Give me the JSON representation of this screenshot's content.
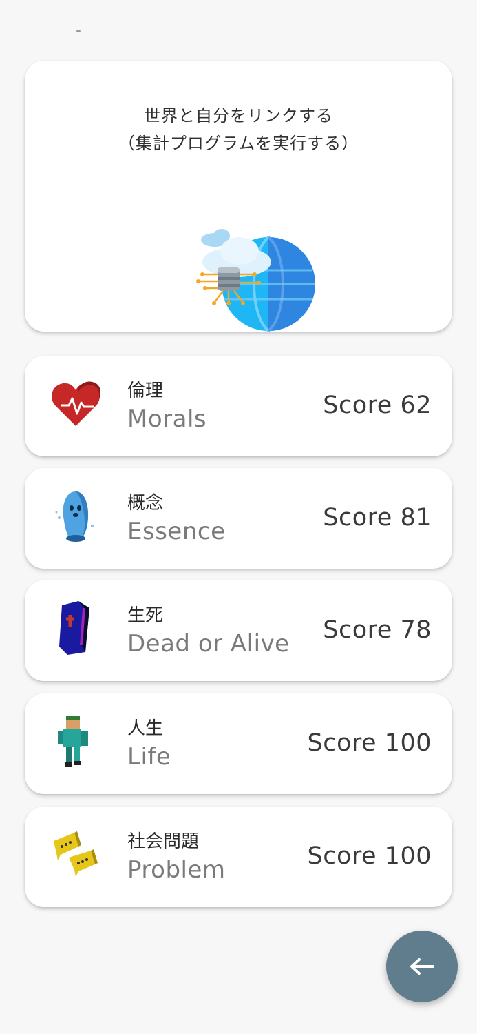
{
  "hero": {
    "line1": "世界と自分をリンクする",
    "line2": "（集計プログラムを実行する）",
    "illustration": "globe-server-cloud-icon"
  },
  "categories": [
    {
      "jp": "倫理",
      "en": "Morals",
      "score": "Score 62",
      "icon": "heart-pulse-icon",
      "color": "#d32f2f"
    },
    {
      "jp": "概念",
      "en": "Essence",
      "score": "Score 81",
      "icon": "ghost-icon",
      "color": "#5aa9e6"
    },
    {
      "jp": "生死",
      "en": "Dead or Alive",
      "score": "Score 78",
      "icon": "coffin-icon",
      "color": "#1a237e"
    },
    {
      "jp": "人生",
      "en": "Life",
      "score": "Score 100",
      "icon": "person-icon",
      "color": "#26a69a"
    },
    {
      "jp": "社会問題",
      "en": "Problem",
      "score": "Score 100",
      "icon": "chat-bubbles-icon",
      "color": "#e6c619"
    }
  ],
  "fab": {
    "icon": "arrow-left-icon",
    "color": "#5f7d8c"
  }
}
